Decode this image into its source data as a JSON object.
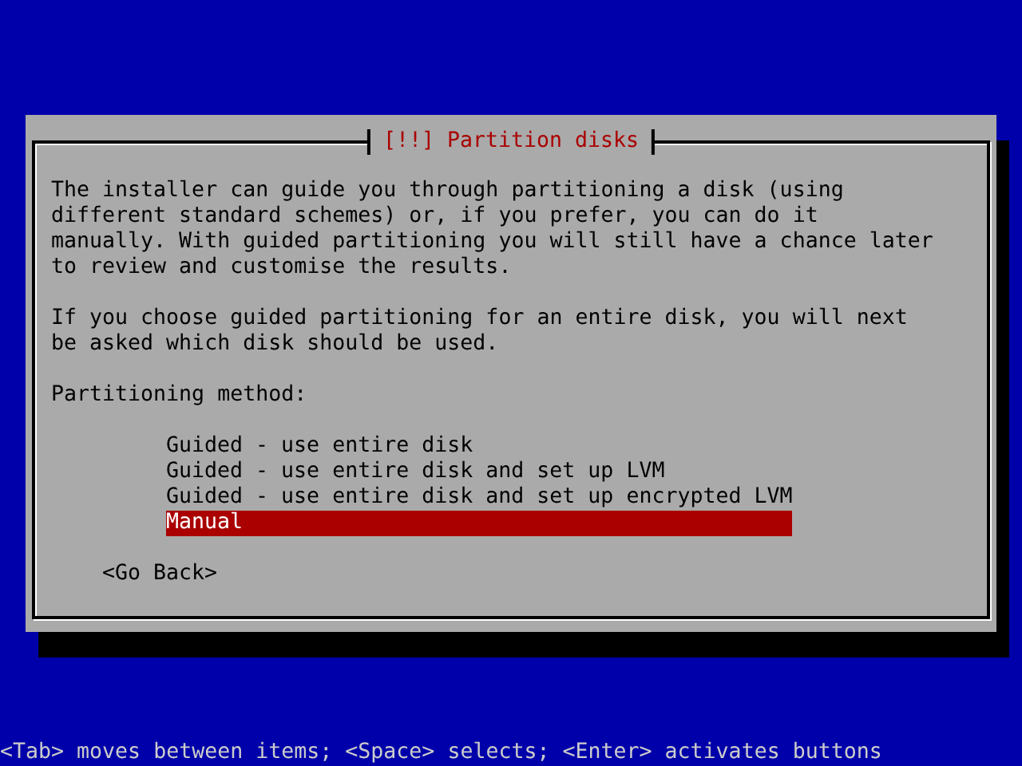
{
  "dialog": {
    "title": "[!!] Partition disks",
    "paragraphs": [
      "The installer can guide you through partitioning a disk (using different standard schemes) or, if you prefer, you can do it manually. With guided partitioning you will still have a chance later to review and customise the results.",
      "If you choose guided partitioning for an entire disk, you will next be asked which disk should be used."
    ],
    "prompt": "Partitioning method:",
    "options": [
      {
        "label": "Guided - use entire disk",
        "selected": false
      },
      {
        "label": "Guided - use entire disk and set up LVM",
        "selected": false
      },
      {
        "label": "Guided - use entire disk and set up encrypted LVM",
        "selected": false
      },
      {
        "label": "Manual",
        "selected": true
      }
    ],
    "back_button": "<Go Back>"
  },
  "status_bar": "<Tab> moves between items; <Space> selects; <Enter> activates buttons"
}
